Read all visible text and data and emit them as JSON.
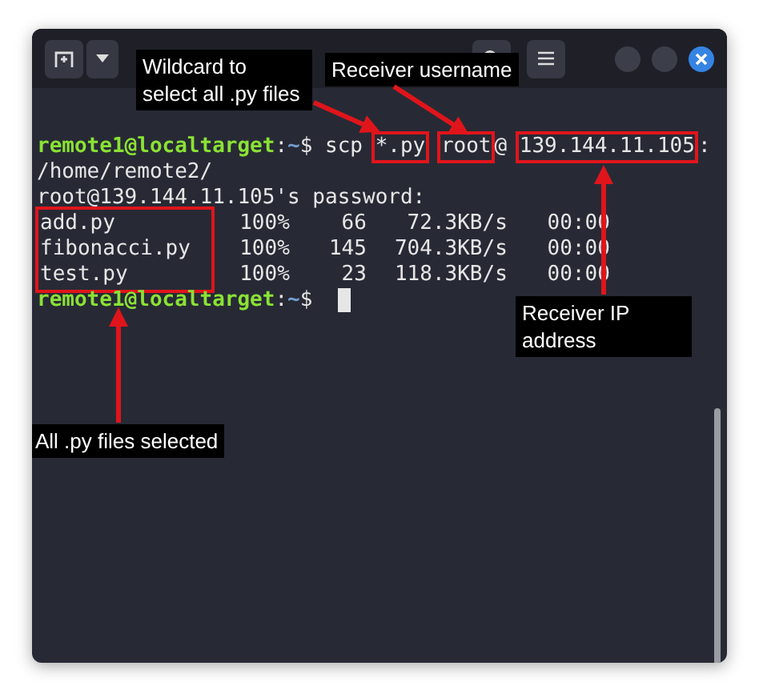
{
  "header": {
    "buttons": [
      {
        "kind": "new-tab"
      },
      {
        "kind": "dropdown"
      },
      {
        "kind": "search"
      },
      {
        "kind": "menu"
      },
      {
        "kind": "minimize"
      },
      {
        "kind": "maximize"
      },
      {
        "kind": "close"
      }
    ]
  },
  "terminal": {
    "lines": [
      {
        "kind": "prompt",
        "user": "remote1@localtarget",
        "separator": ":",
        "path": "~",
        "symbol": "$",
        "segments": [
          {
            "text": "scp"
          },
          {
            "text": "*.py",
            "highlighted": true
          },
          {
            "text": "root",
            "highlighted": true
          },
          {
            "text": "@"
          },
          {
            "text": "139.144.11.105",
            "highlighted": true
          },
          {
            "text": ":"
          }
        ]
      },
      {
        "kind": "output",
        "text": "/home/remote2/"
      },
      {
        "kind": "output",
        "text": "root@139.144.11.105's password:"
      },
      {
        "kind": "transfers",
        "highlighted": true,
        "rows": [
          {
            "name": "add.py",
            "percent": "100%",
            "size": "66",
            "speed": "72.3KB/s",
            "time": "00:00"
          },
          {
            "name": "fibonacci.py",
            "percent": "100%",
            "size": "145",
            "speed": "704.3KB/s",
            "time": "00:00"
          },
          {
            "name": "test.py",
            "percent": "100%",
            "size": "23",
            "speed": "118.3KB/s",
            "time": "00:00"
          }
        ]
      },
      {
        "kind": "prompt",
        "user": "remote1@localtarget",
        "separator": ":",
        "path": "~",
        "symbol": "$",
        "cursor": true
      }
    ]
  },
  "annotations": [
    {
      "kind": "wildcard",
      "text": "Wildcard to select all .py files"
    },
    {
      "kind": "username",
      "text": "Receiver username"
    },
    {
      "kind": "ip",
      "text": "Receiver IP address"
    },
    {
      "kind": "files",
      "text": "All .py files selected"
    }
  ]
}
